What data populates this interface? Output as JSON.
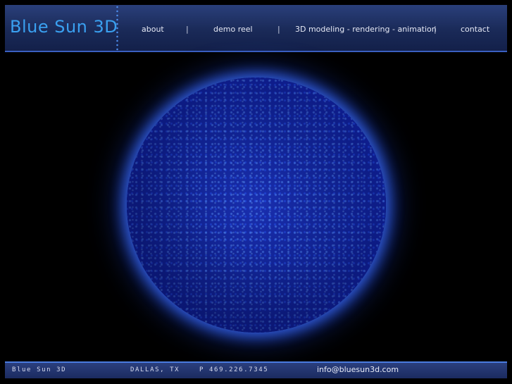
{
  "header": {
    "logo": "Blue Sun 3D",
    "nav": [
      {
        "label": "about"
      },
      {
        "label": "demo reel"
      },
      {
        "label": "3D modeling - rendering - animation"
      },
      {
        "label": "contact"
      }
    ],
    "separator": "|"
  },
  "footer": {
    "company": "Blue Sun 3D",
    "location": "DALLAS, TX",
    "phone": "P 469.226.7345",
    "email": "info@bluesun3d.com"
  },
  "colors": {
    "accent": "#3aa0f0",
    "header_bg": "#1a2a58",
    "sun_blue": "#1c45e0"
  }
}
